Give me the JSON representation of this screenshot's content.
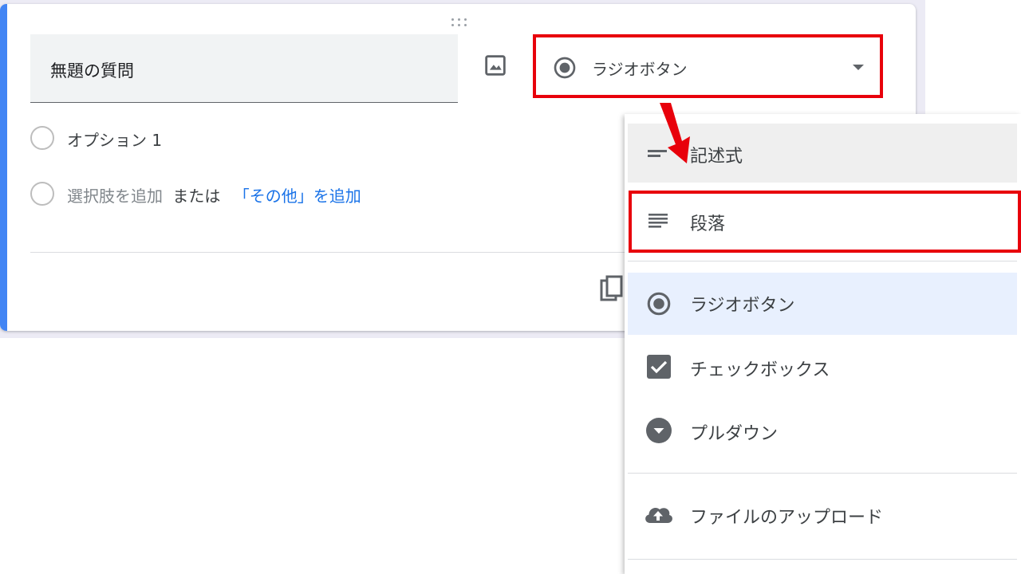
{
  "question": {
    "title": "無題の質問",
    "type_select_label": "ラジオボタン",
    "options": [
      {
        "label": "オプション 1"
      }
    ],
    "add_option": {
      "label": "選択肢を追加",
      "or_text": "または",
      "other_link": "「その他」を追加"
    }
  },
  "type_menu": {
    "items": [
      {
        "label": "記述式",
        "icon": "short-answer-icon",
        "state": "hover"
      },
      {
        "label": "段落",
        "icon": "paragraph-icon",
        "state": "highlighted"
      },
      {
        "label": "ラジオボタン",
        "icon": "radio-button-icon",
        "state": "selected"
      },
      {
        "label": "チェックボックス",
        "icon": "checkbox-icon",
        "state": "normal"
      },
      {
        "label": "プルダウン",
        "icon": "dropdown-icon",
        "state": "normal"
      },
      {
        "label": "ファイルのアップロード",
        "icon": "cloud-upload-icon",
        "state": "normal"
      }
    ]
  },
  "colors": {
    "accent": "#4285f4",
    "annotation_red": "#e8000b",
    "link": "#1a73e8",
    "selected_bg": "#e8f0fe"
  },
  "annotation": {
    "arrow_icon": "red-arrow-icon"
  }
}
